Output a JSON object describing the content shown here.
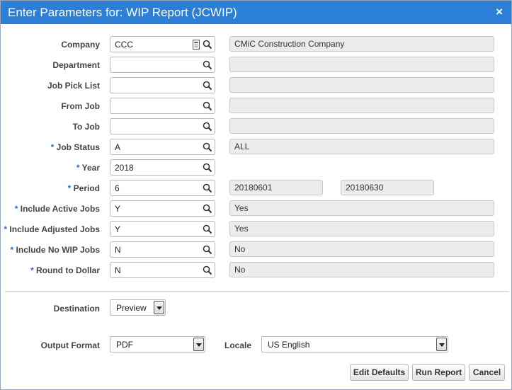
{
  "window": {
    "title": "Enter Parameters for: WIP Report (JCWIP)",
    "close_symbol": "×"
  },
  "required_marker": "*",
  "fields": [
    {
      "label": "Company",
      "required": false,
      "value": "CCC",
      "has_calendar": true,
      "desc": [
        "CMiC Construction Company"
      ]
    },
    {
      "label": "Department",
      "required": false,
      "value": "",
      "desc": [
        ""
      ]
    },
    {
      "label": "Job Pick List",
      "required": false,
      "value": "",
      "desc": [
        ""
      ]
    },
    {
      "label": "From Job",
      "required": false,
      "value": "",
      "desc": [
        ""
      ]
    },
    {
      "label": "To Job",
      "required": false,
      "value": "",
      "desc": [
        ""
      ]
    },
    {
      "label": "Job Status",
      "required": true,
      "value": "A",
      "desc": [
        "ALL"
      ]
    },
    {
      "label": "Year",
      "required": true,
      "value": "2018",
      "desc": []
    },
    {
      "label": "Period",
      "required": true,
      "value": "6",
      "desc": [
        "20180601",
        "20180630"
      ]
    },
    {
      "label": "Include Active Jobs",
      "required": true,
      "value": "Y",
      "desc": [
        "Yes"
      ]
    },
    {
      "label": "Include Adjusted Jobs",
      "required": true,
      "value": "Y",
      "desc": [
        "Yes"
      ]
    },
    {
      "label": "Include No WIP Jobs",
      "required": true,
      "value": "N",
      "desc": [
        "No"
      ]
    },
    {
      "label": "Round to Dollar",
      "required": true,
      "value": "N",
      "desc": [
        "No"
      ]
    }
  ],
  "destination": {
    "label": "Destination",
    "value": "Preview"
  },
  "output_format": {
    "label": "Output Format",
    "value": "PDF"
  },
  "locale": {
    "label": "Locale",
    "value": "US English"
  },
  "buttons": {
    "edit_defaults": "Edit Defaults",
    "run_report": "Run Report",
    "cancel": "Cancel"
  },
  "colors": {
    "titlebar": "#2b7fd6",
    "required": "#2b6fc0",
    "readonly_bg": "#ececec"
  },
  "icons": {
    "lookup": "magnifier-icon",
    "calendar": "calendar-icon",
    "dropdown": "chevron-down-icon"
  }
}
